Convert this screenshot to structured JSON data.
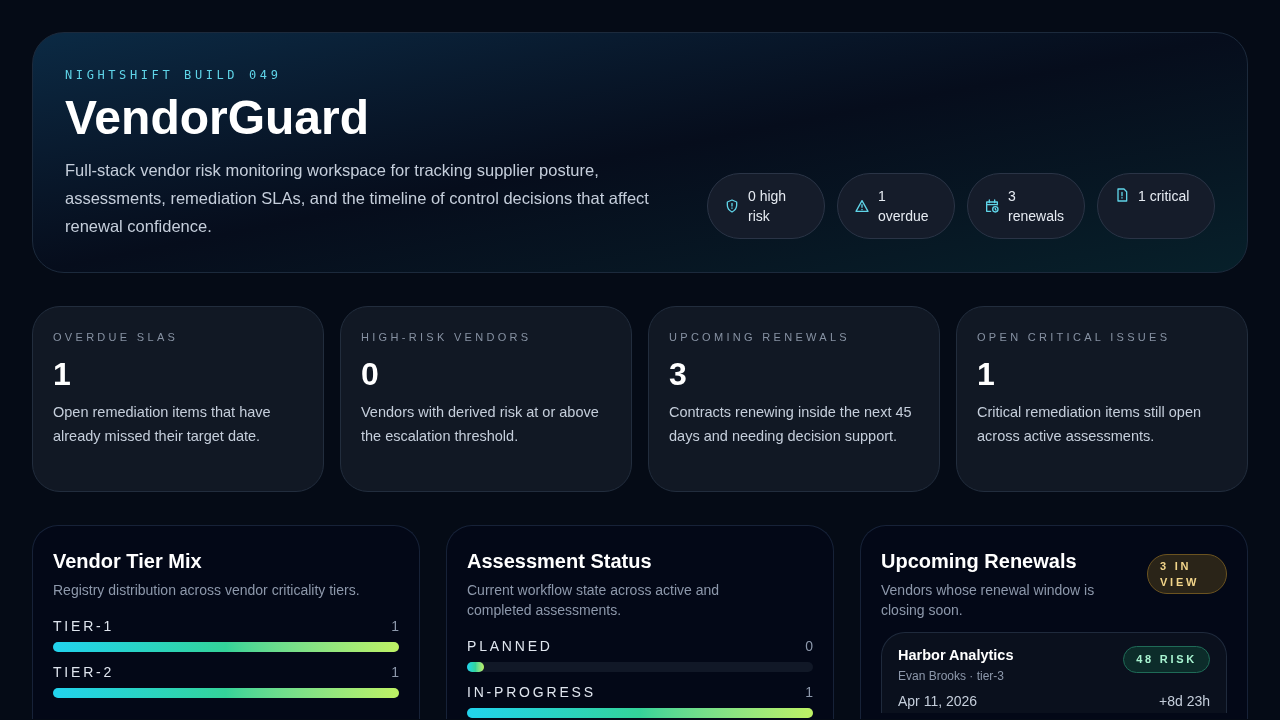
{
  "hero": {
    "eyebrow": "NIGHTSHIFT BUILD 049",
    "title": "VendorGuard",
    "description": "Full-stack vendor risk monitoring workspace for tracking supplier posture, assessments, remediation SLAs, and the timeline of control decisions that affect renewal confidence.",
    "pills": [
      {
        "kind": "shield",
        "label": "0 high risk"
      },
      {
        "kind": "warning",
        "label": "1 overdue"
      },
      {
        "kind": "calendar",
        "label": "3 renewals"
      },
      {
        "kind": "document",
        "label": "1 critical"
      }
    ]
  },
  "stats": [
    {
      "label": "OVERDUE SLAS",
      "value": "1",
      "description": "Open remediation items that have already missed their target date."
    },
    {
      "label": "HIGH-RISK VENDORS",
      "value": "0",
      "description": "Vendors with derived risk at or above the escalation threshold."
    },
    {
      "label": "UPCOMING RENEWALS",
      "value": "3",
      "description": "Contracts renewing inside the next 45 days and needing decision support."
    },
    {
      "label": "OPEN CRITICAL ISSUES",
      "value": "1",
      "description": "Critical remediation items still open across active assessments."
    }
  ],
  "tier_mix": {
    "title": "Vendor Tier Mix",
    "subtitle": "Registry distribution across vendor criticality tiers.",
    "rows": [
      {
        "label": "TIER-1",
        "count": "1",
        "level": 1
      },
      {
        "label": "TIER-2",
        "count": "1",
        "level": 1
      }
    ]
  },
  "assessment_status": {
    "title": "Assessment Status",
    "subtitle": "Current workflow state across active and completed assessments.",
    "rows": [
      {
        "label": "PLANNED",
        "count": "0",
        "level": 0.05
      },
      {
        "label": "IN-PROGRESS",
        "count": "1",
        "level": 1
      }
    ]
  },
  "renewals": {
    "title": "Upcoming Renewals",
    "subtitle": "Vendors whose renewal window is closing soon.",
    "badge": "3 IN VIEW",
    "items": [
      {
        "vendor": "Harbor Analytics",
        "meta": "Evan Brooks · tier-3",
        "risk": "48 RISK",
        "date": "Apr 11, 2026",
        "countdown": "+8d 23h"
      }
    ]
  }
}
